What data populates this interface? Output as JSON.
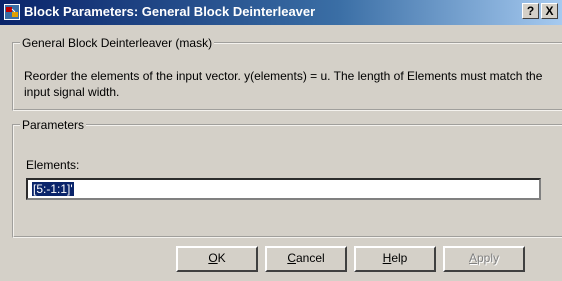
{
  "window": {
    "title": "Block Parameters: General Block Deinterleaver"
  },
  "titlebar_buttons": {
    "help": "?",
    "close": "X"
  },
  "mask_group": {
    "legend": "General Block Deinterleaver (mask)",
    "description": "Reorder the elements of the input vector. y(elements) = u.  The length of Elements must match the input signal width."
  },
  "parameters": {
    "legend": "Parameters",
    "elements_label": "Elements:",
    "elements_value": "[5:-1:1]'"
  },
  "buttons": {
    "ok": {
      "first": "O",
      "rest": "K"
    },
    "cancel": {
      "first": "C",
      "rest": "ancel"
    },
    "help": {
      "first": "H",
      "rest": "elp"
    },
    "apply": {
      "first": "A",
      "rest": "pply",
      "enabled": false
    }
  },
  "colors": {
    "titlebar_start": "#0a246a",
    "titlebar_end": "#a6caf0",
    "face": "#d4d0c8"
  },
  "icons": [
    "simulink-block-icon",
    "help-icon",
    "close-icon"
  ]
}
